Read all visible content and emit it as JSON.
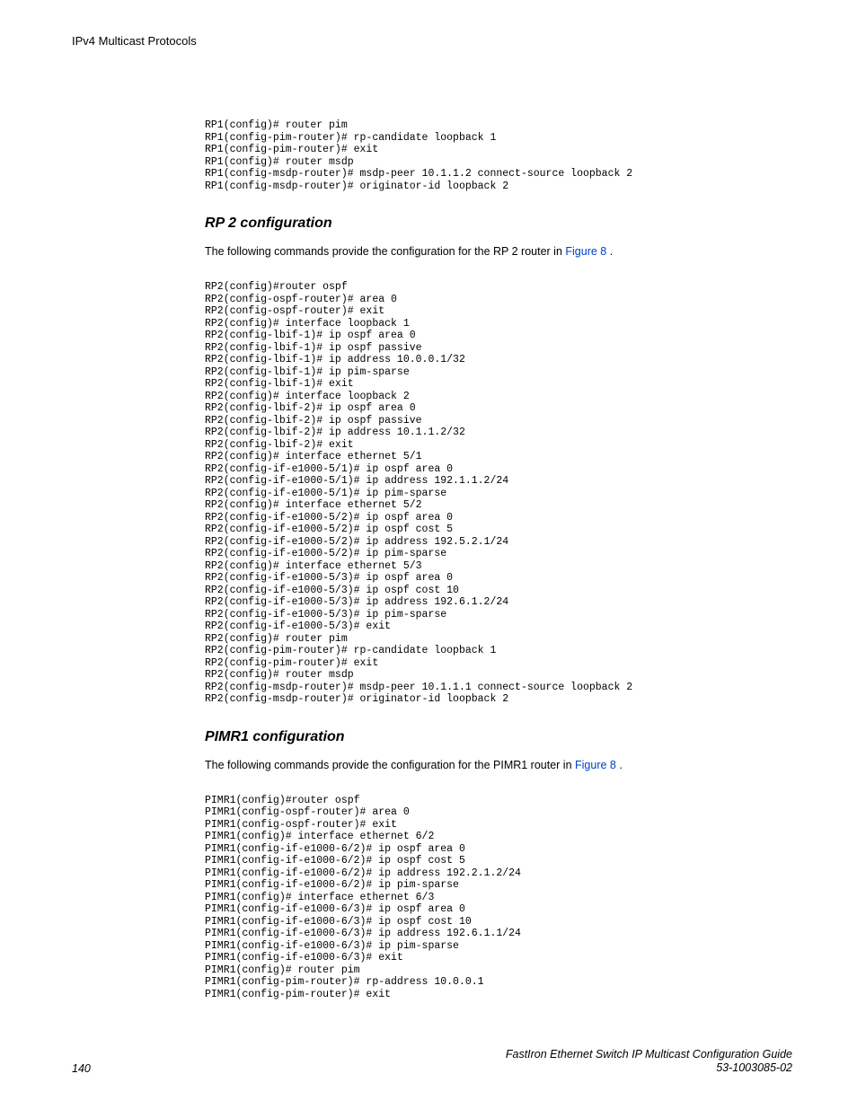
{
  "header": "IPv4 Multicast Protocols",
  "code_block_1": "RP1(config)# router pim\nRP1(config-pim-router)# rp-candidate loopback 1\nRP1(config-pim-router)# exit\nRP1(config)# router msdp\nRP1(config-msdp-router)# msdp-peer 10.1.1.2 connect-source loopback 2\nRP1(config-msdp-router)# originator-id loopback 2",
  "section_rp2": {
    "title": "RP 2 configuration",
    "intro_pre": "The following commands provide the configuration for the RP 2 router in ",
    "intro_link": "Figure 8",
    "intro_post": " .",
    "code": "RP2(config)#router ospf\nRP2(config-ospf-router)# area 0\nRP2(config-ospf-router)# exit\nRP2(config)# interface loopback 1\nRP2(config-lbif-1)# ip ospf area 0\nRP2(config-lbif-1)# ip ospf passive\nRP2(config-lbif-1)# ip address 10.0.0.1/32\nRP2(config-lbif-1)# ip pim-sparse\nRP2(config-lbif-1)# exit\nRP2(config)# interface loopback 2\nRP2(config-lbif-2)# ip ospf area 0\nRP2(config-lbif-2)# ip ospf passive\nRP2(config-lbif-2)# ip address 10.1.1.2/32\nRP2(config-lbif-2)# exit\nRP2(config)# interface ethernet 5/1\nRP2(config-if-e1000-5/1)# ip ospf area 0\nRP2(config-if-e1000-5/1)# ip address 192.1.1.2/24\nRP2(config-if-e1000-5/1)# ip pim-sparse\nRP2(config)# interface ethernet 5/2\nRP2(config-if-e1000-5/2)# ip ospf area 0\nRP2(config-if-e1000-5/2)# ip ospf cost 5\nRP2(config-if-e1000-5/2)# ip address 192.5.2.1/24\nRP2(config-if-e1000-5/2)# ip pim-sparse\nRP2(config)# interface ethernet 5/3\nRP2(config-if-e1000-5/3)# ip ospf area 0\nRP2(config-if-e1000-5/3)# ip ospf cost 10\nRP2(config-if-e1000-5/3)# ip address 192.6.1.2/24\nRP2(config-if-e1000-5/3)# ip pim-sparse\nRP2(config-if-e1000-5/3)# exit\nRP2(config)# router pim\nRP2(config-pim-router)# rp-candidate loopback 1\nRP2(config-pim-router)# exit\nRP2(config)# router msdp\nRP2(config-msdp-router)# msdp-peer 10.1.1.1 connect-source loopback 2\nRP2(config-msdp-router)# originator-id loopback 2"
  },
  "section_pimr1": {
    "title": "PIMR1 configuration",
    "intro_pre": "The following commands provide the configuration for the PIMR1 router in ",
    "intro_link": "Figure 8",
    "intro_post": " .",
    "code": "PIMR1(config)#router ospf\nPIMR1(config-ospf-router)# area 0\nPIMR1(config-ospf-router)# exit\nPIMR1(config)# interface ethernet 6/2\nPIMR1(config-if-e1000-6/2)# ip ospf area 0\nPIMR1(config-if-e1000-6/2)# ip ospf cost 5\nPIMR1(config-if-e1000-6/2)# ip address 192.2.1.2/24\nPIMR1(config-if-e1000-6/2)# ip pim-sparse\nPIMR1(config)# interface ethernet 6/3\nPIMR1(config-if-e1000-6/3)# ip ospf area 0\nPIMR1(config-if-e1000-6/3)# ip ospf cost 10\nPIMR1(config-if-e1000-6/3)# ip address 192.6.1.1/24\nPIMR1(config-if-e1000-6/3)# ip pim-sparse\nPIMR1(config-if-e1000-6/3)# exit\nPIMR1(config)# router pim\nPIMR1(config-pim-router)# rp-address 10.0.0.1\nPIMR1(config-pim-router)# exit"
  },
  "footer": {
    "page": "140",
    "title": "FastIron Ethernet Switch IP Multicast Configuration Guide",
    "docnum": "53-1003085-02"
  }
}
